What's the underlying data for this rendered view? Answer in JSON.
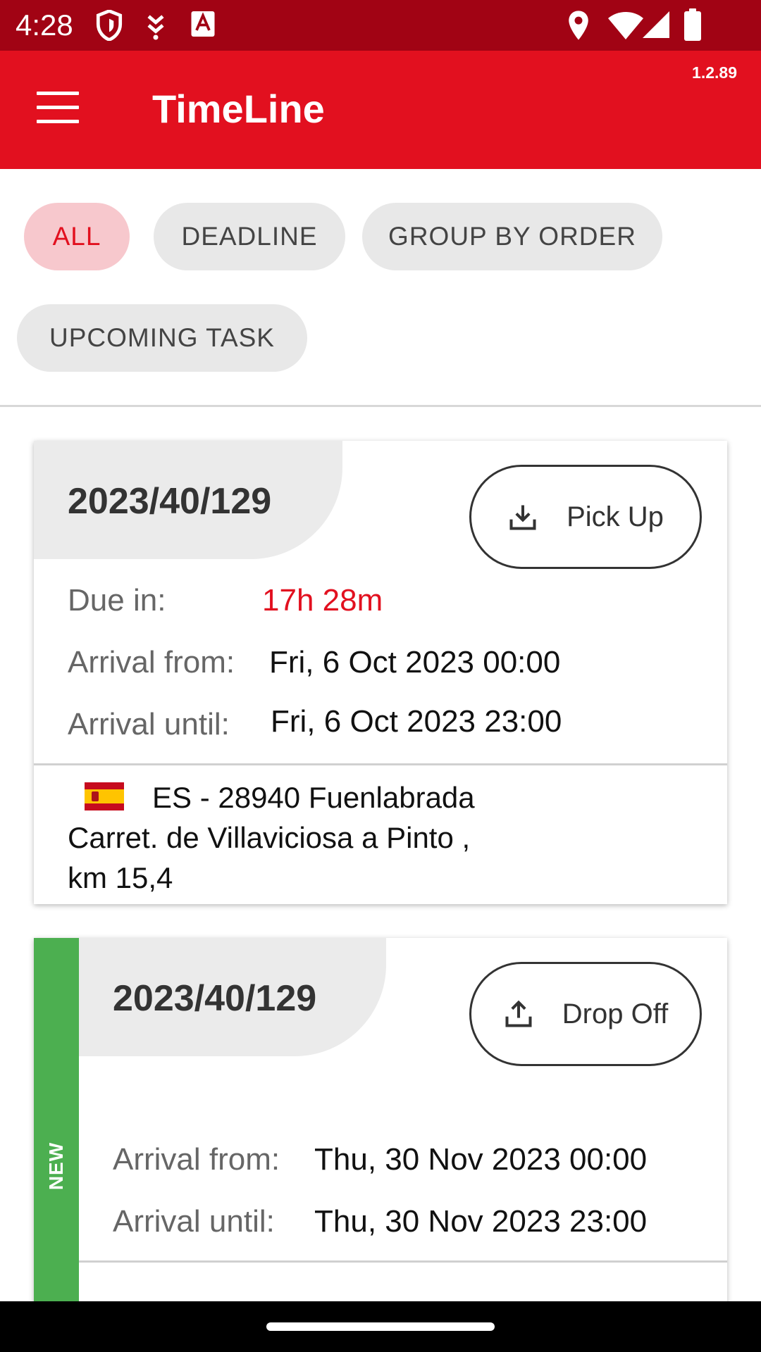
{
  "status_bar": {
    "time": "4:28",
    "icons": [
      "shield-icon",
      "notification-icon",
      "font-icon",
      "location-icon",
      "wifi-icon",
      "signal-icon",
      "battery-icon"
    ]
  },
  "app_bar": {
    "title": "TimeLine",
    "version": "1.2.89",
    "menu_icon": "hamburger-menu-icon"
  },
  "filters": {
    "all": "ALL",
    "deadline": "DEADLINE",
    "group_by_order": "GROUP BY ORDER",
    "upcoming_task": "UPCOMING TASK",
    "selected": "ALL"
  },
  "cards": [
    {
      "order": "2023/40/129",
      "action": "Pick Up",
      "action_icon": "download-icon",
      "due_label": "Due in:",
      "due_value": "17h 28m",
      "from_label": "Arrival from:",
      "from_value": "Fri, 6 Oct 2023 00:00",
      "until_label": "Arrival until:",
      "until_value": "Fri, 6 Oct 2023 23:00",
      "flag_icon": "spain-flag-icon",
      "address_line1": "ES - 28940 Fuenlabrada",
      "address_line2": "Carret. de Villaviciosa a Pinto ,",
      "address_line3": "km 15,4"
    },
    {
      "badge": "NEW",
      "order": "2023/40/129",
      "action": "Drop Off",
      "action_icon": "upload-icon",
      "from_label": "Arrival from:",
      "from_value": "Thu, 30 Nov 2023 00:00",
      "until_label": "Arrival until:",
      "until_value": "Thu, 30 Nov 2023 23:00"
    }
  ],
  "colors": {
    "brand_red": "#e2101f",
    "status_bar": "#a10314",
    "chip_selected_bg": "#f7c8cd",
    "new_badge": "#4caf50"
  }
}
